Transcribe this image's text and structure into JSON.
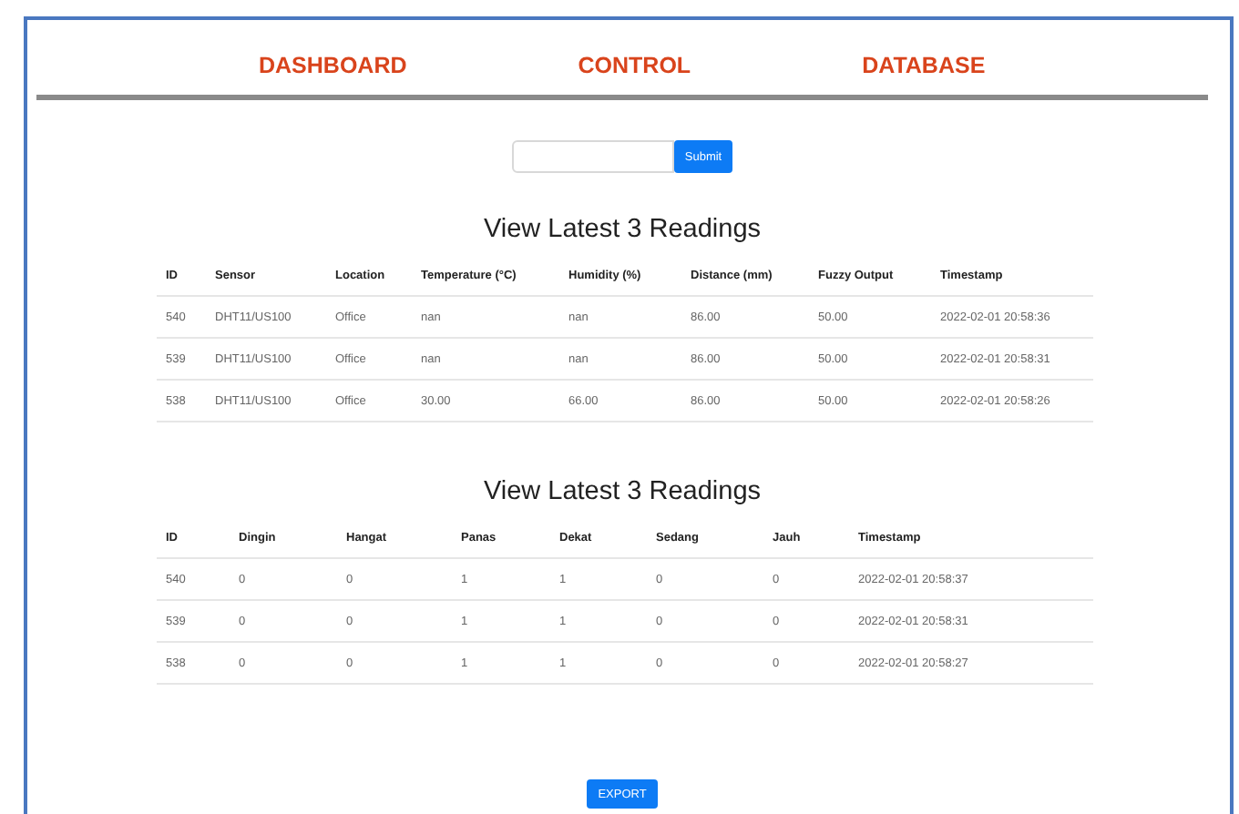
{
  "nav": [
    {
      "label": "DASHBOARD"
    },
    {
      "label": "CONTROL"
    },
    {
      "label": "DATABASE"
    }
  ],
  "form": {
    "submit": "Submit"
  },
  "tables": [
    {
      "title": "View Latest 3 Readings",
      "columns": [
        "ID",
        "Sensor",
        "Location",
        "Temperature (°C)",
        "Humidity (%)",
        "Distance (mm)",
        "Fuzzy Output",
        "Timestamp"
      ],
      "rows": [
        [
          "540",
          "DHT11/US100",
          "Office",
          "nan",
          "nan",
          "86.00",
          "50.00",
          "2022-02-01 20:58:36"
        ],
        [
          "539",
          "DHT11/US100",
          "Office",
          "nan",
          "nan",
          "86.00",
          "50.00",
          "2022-02-01 20:58:31"
        ],
        [
          "538",
          "DHT11/US100",
          "Office",
          "30.00",
          "66.00",
          "86.00",
          "50.00",
          "2022-02-01 20:58:26"
        ]
      ]
    },
    {
      "title": "View Latest 3 Readings",
      "columns": [
        "ID",
        "Dingin",
        "Hangat",
        "Panas",
        "Dekat",
        "Sedang",
        "Jauh",
        "Timestamp"
      ],
      "rows": [
        [
          "540",
          "0",
          "0",
          "1",
          "1",
          "0",
          "0",
          "2022-02-01 20:58:37"
        ],
        [
          "539",
          "0",
          "0",
          "1",
          "1",
          "0",
          "0",
          "2022-02-01 20:58:31"
        ],
        [
          "538",
          "0",
          "0",
          "1",
          "1",
          "0",
          "0",
          "2022-02-01 20:58:27"
        ]
      ]
    }
  ],
  "export": "EXPORT"
}
